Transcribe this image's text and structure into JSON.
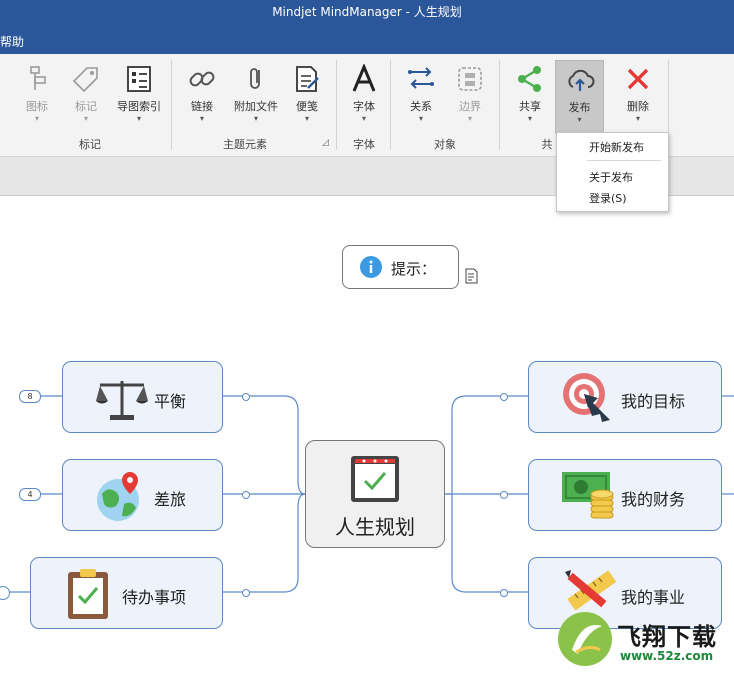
{
  "window": {
    "title": "Mindjet MindManager - 人生规划"
  },
  "menu": {
    "items": [
      "帮助"
    ]
  },
  "ribbon": {
    "groups": [
      {
        "label": "标记",
        "buttons": [
          "图标",
          "标记",
          "导图索引"
        ]
      },
      {
        "label": "主题元素",
        "buttons": [
          "链接",
          "附加文件",
          "便笺"
        ]
      },
      {
        "label": "字体",
        "buttons": [
          "字体"
        ]
      },
      {
        "label": "对象",
        "buttons": [
          "关系",
          "边界"
        ]
      },
      {
        "label": "共",
        "buttons": [
          "共享",
          "发布",
          "删除"
        ]
      }
    ]
  },
  "publish_menu": {
    "items": [
      "开始新发布",
      "关于发布",
      "登录(S)"
    ]
  },
  "map": {
    "hint": "提示：",
    "central": "人生规划",
    "left_topics": [
      {
        "label": "平衡",
        "badge": "8"
      },
      {
        "label": "差旅",
        "badge": "4"
      },
      {
        "label": "待办事项",
        "badge": ""
      }
    ],
    "right_topics": [
      {
        "label": "我的目标"
      },
      {
        "label": "我的财务"
      },
      {
        "label": "我的事业"
      }
    ]
  },
  "watermark": {
    "text": "飞翔下载",
    "url": "www.52z.com"
  },
  "colors": {
    "title_bar": "#2b579a",
    "topic_border": "#5b8ac6",
    "topic_fill": "#eef3fb",
    "accent_red": "#e53935",
    "accent_green": "#4caf50"
  }
}
